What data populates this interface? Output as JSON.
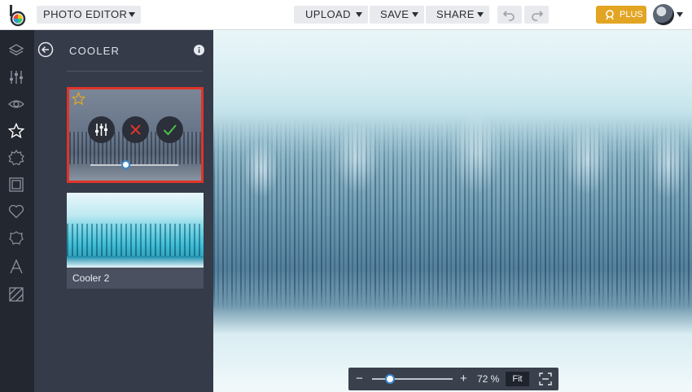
{
  "app": {
    "title": "PHOTO EDITOR"
  },
  "toolbar": {
    "upload_label": "UPLOAD",
    "save_label": "SAVE",
    "share_label": "SHARE",
    "plus_label": "PLUS"
  },
  "colors": {
    "accent_blue": "#3d86c9",
    "plus_gold": "#e2a523",
    "selected_border": "#e0342a",
    "confirm_green": "#4cc24c",
    "cancel_red": "#e0342a",
    "star_gold": "#e2a523"
  },
  "rail": {
    "icons": [
      "layers-icon",
      "sliders-icon",
      "eye-icon",
      "star-icon",
      "badge-icon",
      "frame-icon",
      "heart-icon",
      "texture-icon",
      "text-icon",
      "pattern-icon"
    ]
  },
  "panel": {
    "title": "COOLER",
    "presets": [
      {
        "label": "",
        "selected": true,
        "intensity": 0.4,
        "favorite": true
      },
      {
        "label": "Cooler 2",
        "selected": false
      }
    ]
  },
  "zoom": {
    "minus": "−",
    "plus": "+",
    "percent": "72 %",
    "fit_label": "Fit",
    "level_fraction": 0.17
  }
}
